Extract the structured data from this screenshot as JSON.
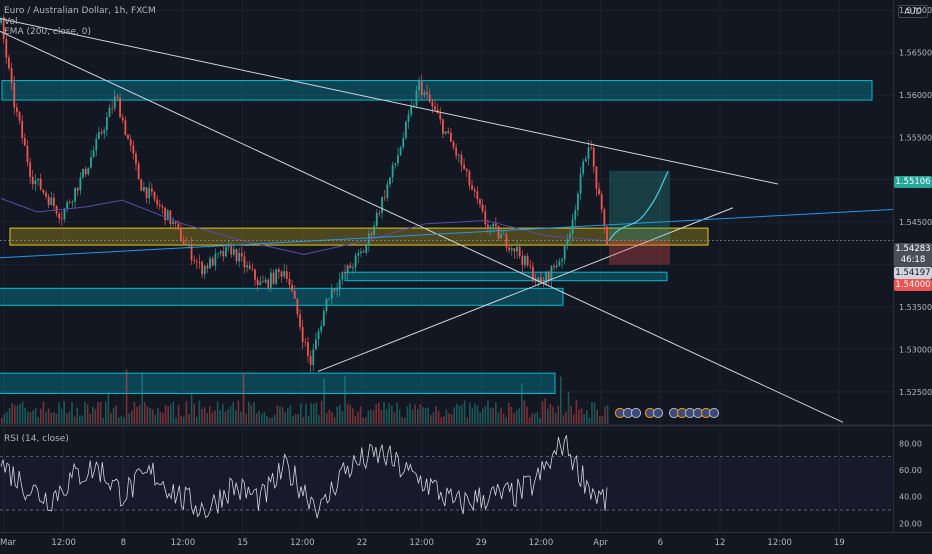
{
  "header": {
    "symbol_line": "Euro / Australian Dollar, 1h, FXCM",
    "vol_label": "Vol",
    "ema_label": "EMA (200, close, 0)",
    "currency": "AUD"
  },
  "rsi_label": "RSI (14, close)",
  "price_tags": {
    "current": "1.55106",
    "last": "1.54283",
    "countdown": "46:18",
    "ema": "1.54197",
    "stop": "1.54000"
  },
  "colors": {
    "background": "#131722",
    "up": "#26a69a",
    "down": "#ef5350",
    "ema": "#5b4aa8",
    "zone_teal": "#00bcd4",
    "zone_yellow": "#e6c619",
    "trendline": "#d1d4dc",
    "blue_trendline": "#2196f3",
    "rsi": "#d1d4dc"
  },
  "chart_data": {
    "type": "candlestick",
    "title": "Euro / Australian Dollar, 1h, FXCM",
    "ylim": [
      1.5212,
      1.5712
    ],
    "y_ticks": [
      "1.57000",
      "1.56500",
      "1.56000",
      "1.55500",
      "1.55000",
      "1.54500",
      "1.54000",
      "1.53500",
      "1.53000",
      "1.52500"
    ],
    "x_ticks": [
      "Mar",
      "12:00",
      "8",
      "12:00",
      "15",
      "12:00",
      "22",
      "12:00",
      "29",
      "12:00",
      "Apr",
      "6",
      "12",
      "12:00",
      "19"
    ],
    "price_path": [
      [
        0,
        1.5685
      ],
      [
        0.02,
        1.5595
      ],
      [
        0.05,
        1.5505
      ],
      [
        0.1,
        1.5458
      ],
      [
        0.14,
        1.5512
      ],
      [
        0.19,
        1.5598
      ],
      [
        0.23,
        1.5495
      ],
      [
        0.28,
        1.5452
      ],
      [
        0.33,
        1.5395
      ],
      [
        0.38,
        1.5418
      ],
      [
        0.43,
        1.5375
      ],
      [
        0.47,
        1.5395
      ],
      [
        0.51,
        1.5282
      ],
      [
        0.54,
        1.5365
      ],
      [
        0.6,
        1.5418
      ],
      [
        0.65,
        1.5518
      ],
      [
        0.69,
        1.5612
      ],
      [
        0.72,
        1.5575
      ],
      [
        0.76,
        1.5518
      ],
      [
        0.8,
        1.5448
      ],
      [
        0.85,
        1.5418
      ],
      [
        0.89,
        1.5375
      ],
      [
        0.93,
        1.5415
      ],
      [
        0.95,
        1.5478
      ],
      [
        0.97,
        1.5548
      ],
      [
        0.99,
        1.5462
      ],
      [
        1.0,
        1.5428
      ]
    ],
    "ema_path": [
      [
        0,
        1.5478
      ],
      [
        0.06,
        1.5462
      ],
      [
        0.14,
        1.5468
      ],
      [
        0.2,
        1.5476
      ],
      [
        0.3,
        1.5448
      ],
      [
        0.4,
        1.5428
      ],
      [
        0.5,
        1.5412
      ],
      [
        0.6,
        1.5428
      ],
      [
        0.7,
        1.5448
      ],
      [
        0.8,
        1.5452
      ],
      [
        0.9,
        1.5434
      ],
      [
        1.0,
        1.5428
      ]
    ],
    "last_price": 1.54283,
    "current_price": 1.55106,
    "ema_value": 1.54197,
    "stop_price": 1.54,
    "zones": [
      {
        "color": "teal",
        "y1": 1.5594,
        "y2": 1.5617
      },
      {
        "color": "yellow",
        "y1": 1.5423,
        "y2": 1.5443
      },
      {
        "color": "teal",
        "y1": 1.5381,
        "y2": 1.5391
      },
      {
        "color": "teal",
        "y1": 1.5352,
        "y2": 1.5372
      },
      {
        "color": "teal",
        "y1": 1.5248,
        "y2": 1.5272
      }
    ],
    "rsi": {
      "label": "RSI (14, close)",
      "ylim": [
        15,
        90
      ],
      "y_ticks": [
        "80.00",
        "60.00",
        "40.00",
        "20.00"
      ],
      "upper_band": 70,
      "lower_band": 30,
      "path": [
        [
          0,
          65
        ],
        [
          0.04,
          48
        ],
        [
          0.08,
          38
        ],
        [
          0.12,
          55
        ],
        [
          0.16,
          62
        ],
        [
          0.2,
          42
        ],
        [
          0.25,
          58
        ],
        [
          0.3,
          38
        ],
        [
          0.34,
          30
        ],
        [
          0.38,
          48
        ],
        [
          0.43,
          38
        ],
        [
          0.47,
          62
        ],
        [
          0.5,
          45
        ],
        [
          0.53,
          30
        ],
        [
          0.56,
          58
        ],
        [
          0.6,
          68
        ],
        [
          0.63,
          72
        ],
        [
          0.67,
          58
        ],
        [
          0.71,
          48
        ],
        [
          0.75,
          34
        ],
        [
          0.8,
          40
        ],
        [
          0.85,
          42
        ],
        [
          0.88,
          50
        ],
        [
          0.91,
          68
        ],
        [
          0.93,
          83
        ],
        [
          0.95,
          62
        ],
        [
          0.98,
          42
        ],
        [
          1.0,
          36
        ]
      ]
    }
  }
}
